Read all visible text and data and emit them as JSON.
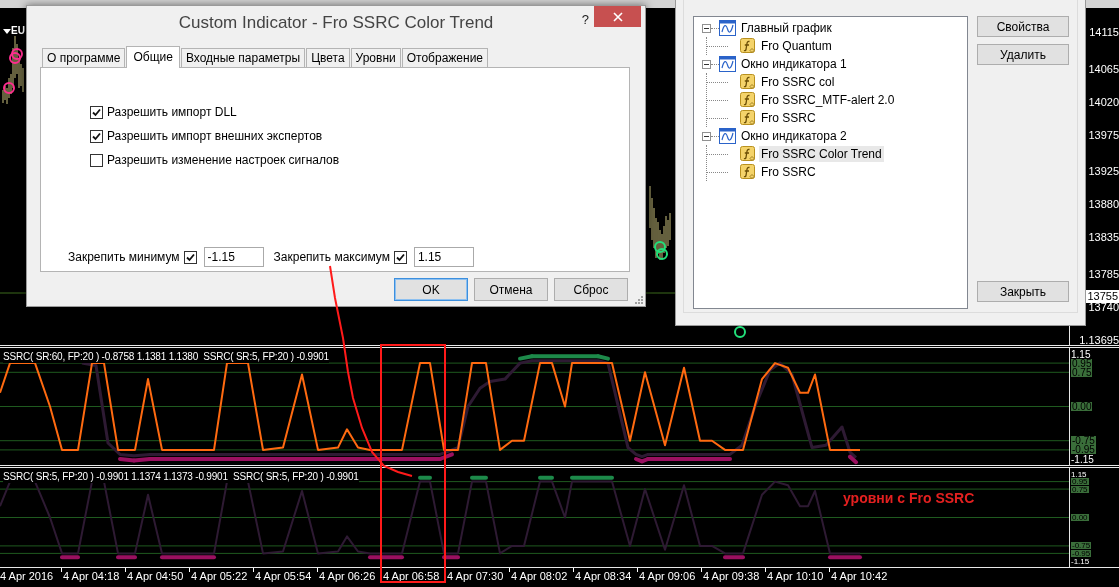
{
  "chart": {
    "symbol_label": "EU",
    "price_axis": [
      {
        "text": "14115",
        "current": false
      },
      {
        "text": "14065",
        "current": false
      },
      {
        "text": "14020",
        "current": false
      },
      {
        "text": "13975",
        "current": false
      },
      {
        "text": "13925",
        "current": false
      },
      {
        "text": "13880",
        "current": false
      },
      {
        "text": "13835",
        "current": false
      },
      {
        "text": "13785",
        "current": false
      },
      {
        "text": "13755",
        "current": true
      },
      {
        "text": "13740",
        "current": false
      },
      {
        "text": "1.13695",
        "current": false
      }
    ],
    "indicator_windows": [
      {
        "label": "SSRC( SR:60, FP:20 ) -0.8758 1.1381 1.1380  SSRC( SR:5, FP:20 ) -0.9901",
        "levels": [
          {
            "text": "1.15",
            "boxed": false
          },
          {
            "text": "0.95",
            "boxed": true
          },
          {
            "text": "0.75",
            "boxed": true
          },
          {
            "text": "0.00",
            "boxed": true
          },
          {
            "text": "-0.75",
            "boxed": true
          },
          {
            "text": "-0.95",
            "boxed": true
          },
          {
            "text": "-1.15",
            "boxed": false
          }
        ]
      },
      {
        "label": "SSRC( SR:5, FP:20 ) -0.9901 1.1374 1.1373 -0.9901  SSRC( SR:5, FP:20 ) -0.9901",
        "levels": [
          {
            "text": "1.15",
            "boxed": false
          },
          {
            "text": "0.95",
            "boxed": true
          },
          {
            "text": "0.75",
            "boxed": true
          },
          {
            "text": "0.00",
            "boxed": true
          },
          {
            "text": "-0.75",
            "boxed": true
          },
          {
            "text": "-0.95",
            "boxed": true
          },
          {
            "text": "-1.15",
            "boxed": false
          }
        ],
        "annotation": "уровни с Fro SSRC"
      }
    ],
    "time_axis": [
      "4 Apr 2016",
      "4 Apr 04:18",
      "4 Apr 04:50",
      "4 Apr 05:22",
      "4 Apr 05:54",
      "4 Apr 06:26",
      "4 Apr 06:58",
      "4 Apr 07:30",
      "4 Apr 08:02",
      "4 Apr 08:34",
      "4 Apr 09:06",
      "4 Apr 09:38",
      "4 Apr 10:10",
      "4 Apr 10:42"
    ]
  },
  "properties_dialog": {
    "title": "Custom Indicator - Fro SSRC Color Trend",
    "help": "?",
    "tabs": [
      {
        "label": "О программе",
        "selected": false
      },
      {
        "label": "Общие",
        "selected": true
      },
      {
        "label": "Входные параметры",
        "selected": false
      },
      {
        "label": "Цвета",
        "selected": false
      },
      {
        "label": "Уровни",
        "selected": false
      },
      {
        "label": "Отображение",
        "selected": false
      }
    ],
    "checkboxes": [
      {
        "label": "Разрешить импорт DLL",
        "checked": true
      },
      {
        "label": "Разрешить импорт внешних экспертов",
        "checked": true
      },
      {
        "label": "Разрешить изменение настроек сигналов",
        "checked": false
      }
    ],
    "fixed_limits": [
      {
        "label": "Закрепить минимум",
        "checked": true,
        "value": "-1.15"
      },
      {
        "label": "Закрепить максимум",
        "checked": true,
        "value": "1.15"
      }
    ],
    "buttons": [
      {
        "label": "OK",
        "default": true
      },
      {
        "label": "Отмена",
        "default": false
      },
      {
        "label": "Сброс",
        "default": false
      }
    ]
  },
  "indicators_dialog": {
    "tree": [
      {
        "label": "Главный график",
        "kind": "window",
        "expanded": true,
        "selected": false,
        "children": [
          {
            "label": "Fro Quantum",
            "kind": "indicator",
            "selected": false
          }
        ]
      },
      {
        "label": "Окно индикатора 1",
        "kind": "window",
        "expanded": true,
        "selected": false,
        "children": [
          {
            "label": "Fro SSRC col",
            "kind": "indicator",
            "selected": false
          },
          {
            "label": "Fro SSRC_MTF-alert 2.0",
            "kind": "indicator",
            "selected": false
          },
          {
            "label": "Fro SSRC",
            "kind": "indicator",
            "selected": false
          }
        ]
      },
      {
        "label": "Окно индикатора 2",
        "kind": "window",
        "expanded": true,
        "selected": false,
        "children": [
          {
            "label": "Fro SSRC Color Trend",
            "kind": "indicator",
            "selected": true
          },
          {
            "label": "Fro SSRC",
            "kind": "indicator",
            "selected": false
          }
        ]
      }
    ],
    "buttons": [
      "Свойства",
      "Удалить"
    ],
    "close_button": "Закрыть"
  }
}
